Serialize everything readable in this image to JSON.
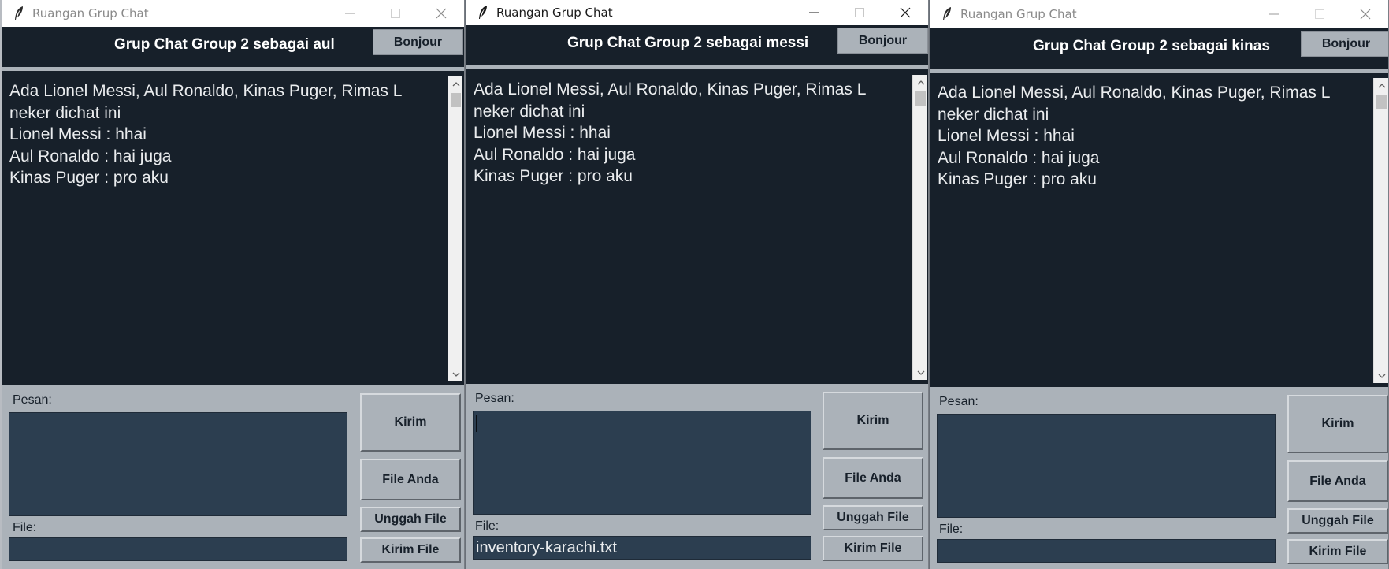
{
  "windows": [
    {
      "title": "Ruangan Grup Chat",
      "header_title": "Grup Chat Group 2 sebagai aul",
      "header_button": "Bonjour",
      "messages": [
        "Ada Lionel Messi, Aul Ronaldo, Kinas Puger, Rimas L",
        "neker dichat ini",
        "Lionel Messi : hhai",
        "Aul Ronaldo : hai juga",
        "Kinas Puger : pro aku"
      ],
      "pesan_label": "Pesan:",
      "file_label": "File:",
      "file_value": "",
      "buttons": {
        "send": "Kirim",
        "your_files": "File Anda",
        "upload": "Unggah File",
        "send_file": "Kirim File"
      }
    },
    {
      "title": "Ruangan Grup Chat",
      "header_title": "Grup Chat Group 2 sebagai messi",
      "header_button": "Bonjour",
      "messages": [
        "Ada Lionel Messi, Aul Ronaldo, Kinas Puger, Rimas L",
        "neker dichat ini",
        "Lionel Messi : hhai",
        "Aul Ronaldo : hai juga",
        "Kinas Puger : pro aku"
      ],
      "pesan_label": "Pesan:",
      "file_label": "File:",
      "file_value": "inventory-karachi.txt",
      "buttons": {
        "send": "Kirim",
        "your_files": "File Anda",
        "upload": "Unggah File",
        "send_file": "Kirim File"
      }
    },
    {
      "title": "Ruangan Grup Chat",
      "header_title": "Grup Chat Group 2 sebagai kinas",
      "header_button": "Bonjour",
      "messages": [
        "Ada Lionel Messi, Aul Ronaldo, Kinas Puger, Rimas L",
        "neker dichat ini",
        "Lionel Messi : hhai",
        "Aul Ronaldo : hai juga",
        "Kinas Puger : pro aku"
      ],
      "pesan_label": "Pesan:",
      "file_label": "File:",
      "file_value": "",
      "buttons": {
        "send": "Kirim",
        "your_files": "File Anda",
        "upload": "Unggah File",
        "send_file": "Kirim File"
      }
    }
  ],
  "colors": {
    "chat_background": "#17202a",
    "panel_background": "#abb2b9",
    "entry_background": "#2c3e50",
    "text_light": "#eaecee"
  },
  "icons": {
    "app": "feather-icon",
    "minimize": "minimize-icon",
    "maximize": "maximize-icon",
    "close": "close-icon",
    "scroll_up": "scroll-up-arrow-icon",
    "scroll_down": "scroll-down-arrow-icon"
  }
}
